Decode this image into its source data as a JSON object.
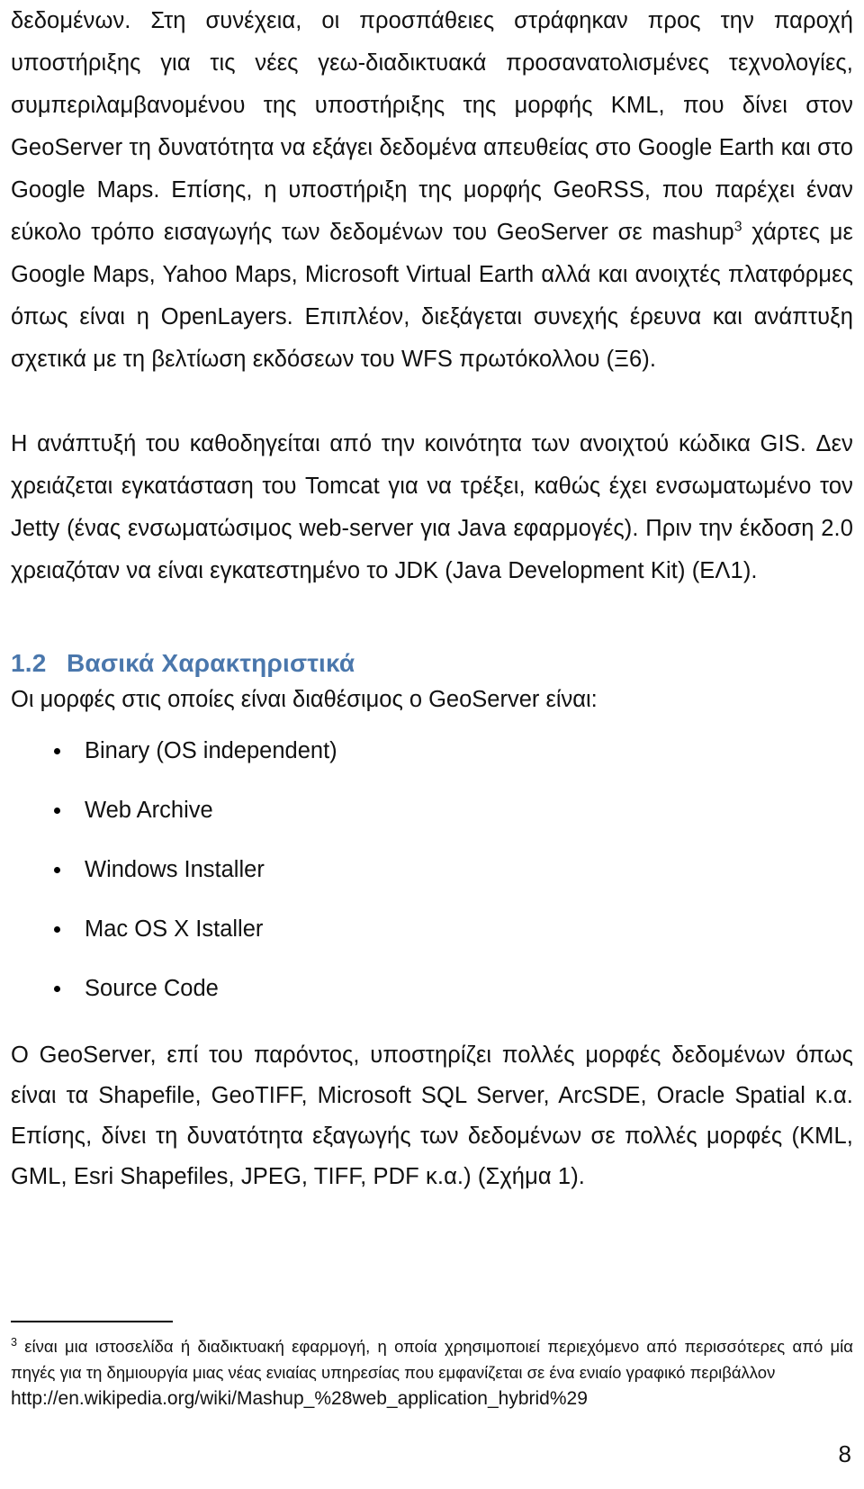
{
  "document": {
    "page_number": "8",
    "accent_color": "#4a77ac",
    "text_color": "#111111"
  },
  "main": {
    "paragraph_1": "δεδομένων. Στη συνέχεια, οι προσπάθειες στράφηκαν προς την παροχή υποστήριξης για τις νέες γεω-διαδικτυακά προσανατολισμένες τεχνολογίες, συμπεριλαμβανομένου της υποστήριξης της μορφής KML, που δίνει στον GeoServer τη δυνατότητα να εξάγει δεδομένα απευθείας στο Google Earth και στο Google Maps. Επίσης, η υποστήριξη της μορφής GeoRSS, που παρέχει έναν εύκολο τρόπο εισαγωγής των δεδομένων του GeoServer σε mashup",
    "paragraph_1_footnote_marker": "3",
    "paragraph_1_cont": " χάρτες με Google Maps, Yahoo Maps, Microsoft Virtual Earth αλλά και ανοιχτές πλατφόρμες όπως είναι η OpenLayers. Επιπλέον, διεξάγεται συνεχής έρευνα και ανάπτυξη σχετικά με τη βελτίωση εκδόσεων του WFS πρωτόκολλου (Ξ6).",
    "paragraph_2": "Η ανάπτυξή του καθοδηγείται από την κοινότητα των ανοιχτού κώδικα GIS. Δεν χρειάζεται εγκατάσταση του Tomcat για να τρέξει, καθώς έχει ενσωματωμένο τον Jetty (ένας ενσωματώσιμος web-server για Java εφαρμογές). Πριν  την έκδοση 2.0 χρειαζόταν να είναι εγκατεστημένο το JDK (Java Development Kit) (ΕΛ1).",
    "section": {
      "number": "1.2",
      "title": "Βασικά Χαρακτηριστικά",
      "intro": "Οι μορφές στις οποίες είναι διαθέσιμος ο GeoServer είναι:",
      "items": [
        "Binary (OS independent)",
        "Web Archive",
        "Windows Installer",
        "Mac OS X Istaller",
        "Source Code"
      ]
    },
    "paragraph_3": "Ο GeoServer, επί του παρόντος, υποστηρίζει πολλές μορφές δεδομένων όπως είναι τα Shapefile, GeoTIFF, Microsoft SQL Server, ArcSDE, Oracle Spatial κ.α. Επίσης, δίνει τη δυνατότητα εξαγωγής των δεδομένων σε πολλές μορφές (KML, GML, Esri Shapefiles, JPEG, TIFF, PDF κ.α.) (Σχήμα 1)."
  },
  "footnote": {
    "marker": "3",
    "text": " είναι μια ιστοσελίδα ή διαδικτυακή εφαρμογή, η οποία χρησιμοποιεί περιεχόμενο από περισσότερες από μία πηγές για τη δημιουργία μιας νέας ενιαίας υπηρεσίας που εμφανίζεται σε ένα ενιαίο γραφικό περιβάλλον",
    "url": "http://en.wikipedia.org/wiki/Mashup_%28web_application_hybrid%29"
  }
}
